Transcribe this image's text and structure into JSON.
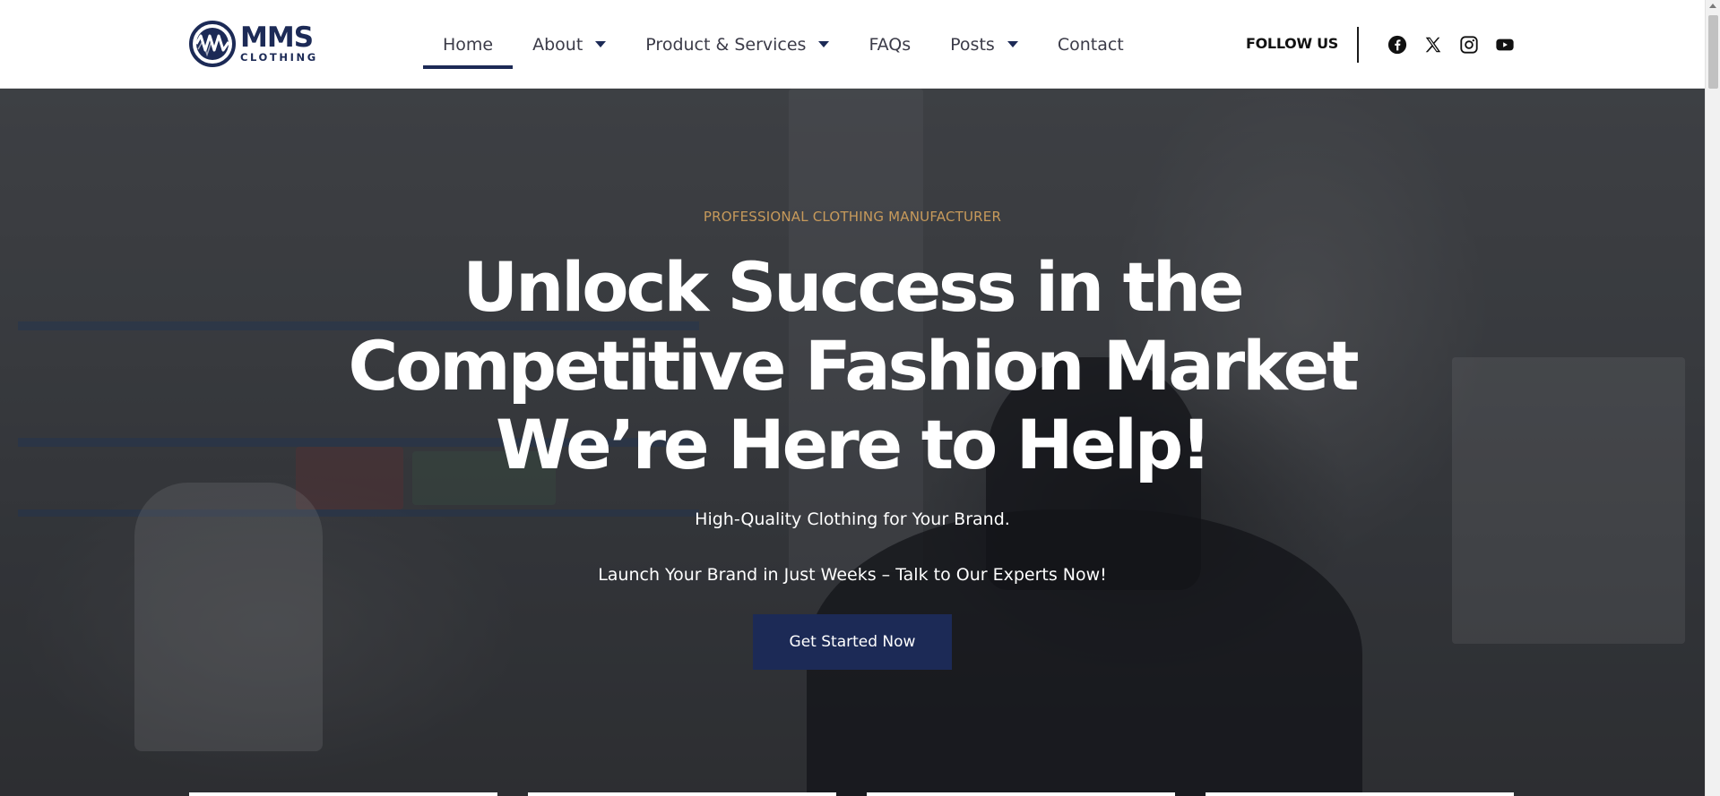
{
  "brand": {
    "logo_main": "MMS",
    "logo_sub": "CLOTHING",
    "colors": {
      "primary": "#1c2a56",
      "accent": "#c79a5b"
    }
  },
  "nav": {
    "items": [
      {
        "label": "Home",
        "has_dropdown": false,
        "active": true
      },
      {
        "label": "About",
        "has_dropdown": true,
        "active": false
      },
      {
        "label": "Product & Services",
        "has_dropdown": true,
        "active": false
      },
      {
        "label": "FAQs",
        "has_dropdown": false,
        "active": false
      },
      {
        "label": "Posts",
        "has_dropdown": true,
        "active": false
      },
      {
        "label": "Contact",
        "has_dropdown": false,
        "active": false
      }
    ]
  },
  "social": {
    "follow_label": "FOLLOW US",
    "icons": [
      "facebook-icon",
      "x-icon",
      "instagram-icon",
      "youtube-icon"
    ]
  },
  "hero": {
    "eyebrow": "PROFESSIONAL CLOTHING MANUFACTURER",
    "headline": [
      "Unlock Success in the",
      "Competitive Fashion Market",
      "We’re Here to Help!"
    ],
    "subtitle": "High-Quality Clothing for Your Brand.",
    "tagline": "Launch Your Brand in Just Weeks – Talk to Our Experts Now!",
    "cta_label": "Get Started Now"
  }
}
